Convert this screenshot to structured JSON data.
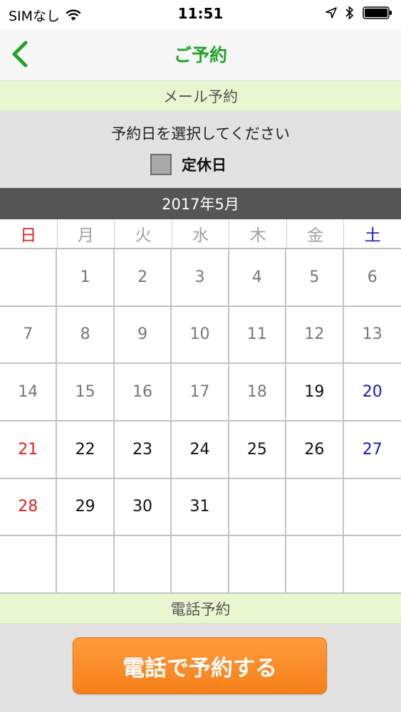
{
  "status_bar": {
    "carrier": "SIMなし",
    "time": "11:51",
    "icons": [
      "wifi-icon",
      "location-arrow-icon",
      "bluetooth-icon",
      "battery-icon"
    ]
  },
  "nav": {
    "back_icon": "chevron-left-icon",
    "title": "ご予約"
  },
  "mail_section": {
    "header": "メール予約",
    "instruction": "予約日を選択してください",
    "legend_label": "定休日"
  },
  "calendar": {
    "month_label": "2017年5月",
    "weekdays": [
      "日",
      "月",
      "火",
      "水",
      "木",
      "金",
      "土"
    ],
    "weeks": [
      [
        "",
        "1",
        "2",
        "3",
        "4",
        "5",
        "6"
      ],
      [
        "7",
        "8",
        "9",
        "10",
        "11",
        "12",
        "13"
      ],
      [
        "14",
        "15",
        "16",
        "17",
        "18",
        "19",
        "20"
      ],
      [
        "21",
        "22",
        "23",
        "24",
        "25",
        "26",
        "27"
      ],
      [
        "28",
        "29",
        "30",
        "31",
        "",
        "",
        ""
      ],
      [
        "",
        "",
        "",
        "",
        "",
        "",
        ""
      ]
    ],
    "first_available_day": 19
  },
  "phone_section": {
    "header": "電話予約",
    "button_label": "電話で予約する"
  },
  "colors": {
    "accent_green": "#22a32a",
    "section_header_bg": "#eaf6d0",
    "sunday_red": "#e02020",
    "saturday_blue": "#1a1ab8",
    "button_orange": "#f6811a",
    "closed_day_gray": "#a9a9a9"
  }
}
